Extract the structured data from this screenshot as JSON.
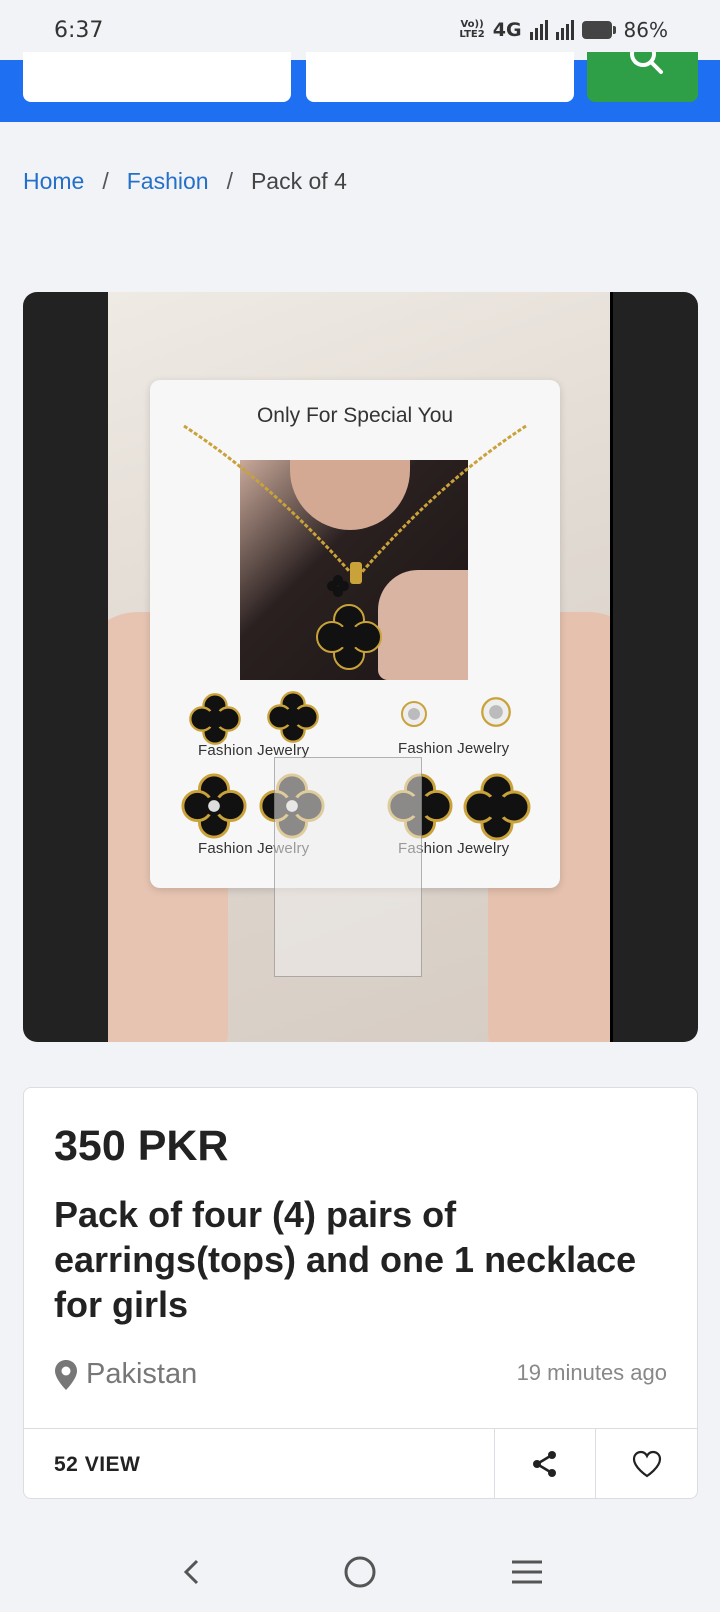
{
  "status_bar": {
    "time": "6:37",
    "volte_top": "Vo))",
    "volte_bottom": "LTE2",
    "network": "4G",
    "battery": "86%",
    "battery_level": 0.86
  },
  "breadcrumb": {
    "home": "Home",
    "category": "Fashion",
    "current": "Pack of 4",
    "separator": "/"
  },
  "gallery": {
    "card_title": "Only For Special You",
    "labels": [
      "Fashion Jewelry",
      "Fashion Jewelry",
      "Fashion Jewelry",
      "Fashion Jewelry"
    ]
  },
  "product": {
    "price": "350 PKR",
    "title": "Pack of four (4) pairs of earrings(tops) and one 1 necklace for girls",
    "location": "Pakistan",
    "posted": "19 minutes ago",
    "views": "52 VIEW"
  },
  "colors": {
    "header_blue": "#1e6ff1",
    "search_green": "#2e9f47",
    "link_blue": "#2470c9"
  },
  "icons": {
    "search": "search-icon",
    "location": "location-pin-icon",
    "share": "share-icon",
    "favorite": "heart-icon",
    "back": "back-icon",
    "home": "home-icon",
    "menu": "menu-icon"
  }
}
